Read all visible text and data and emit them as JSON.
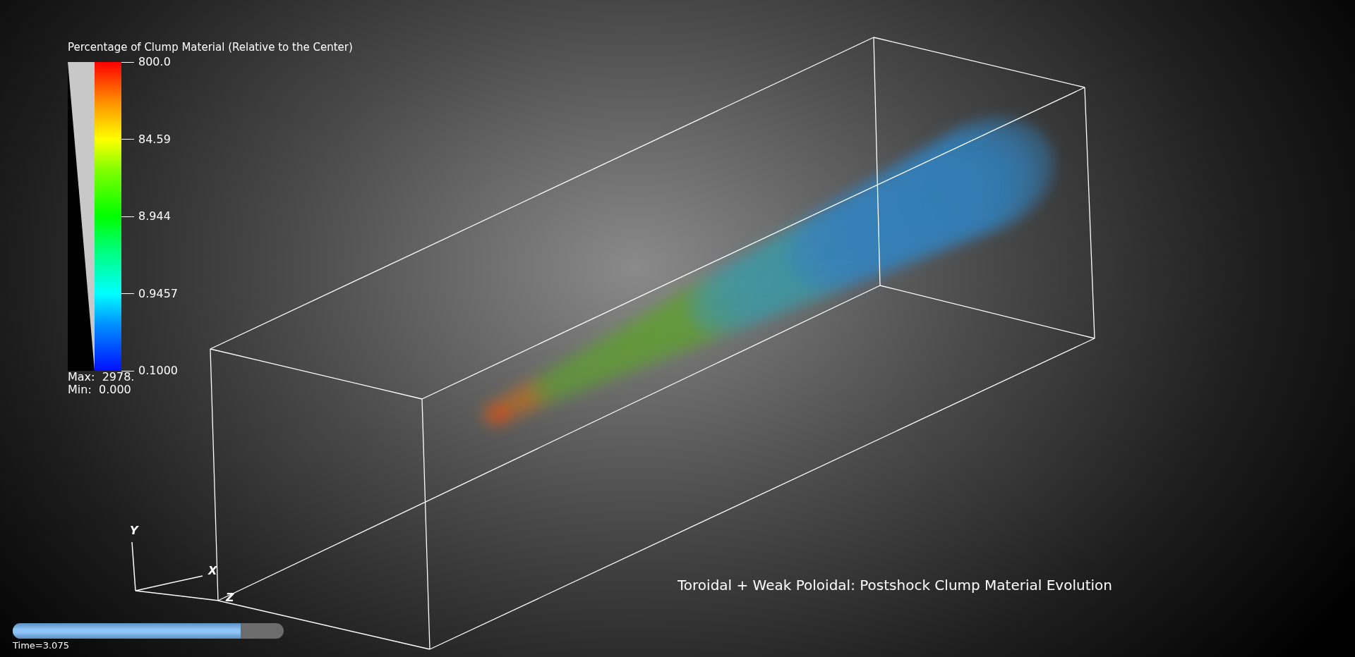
{
  "legend": {
    "title": "Percentage of Clump Material (Relative to the Center)",
    "ticks": [
      "800.0",
      "84.59",
      "8.944",
      "0.9457",
      "0.1000"
    ],
    "max": "Max:  2978.",
    "min": "Min:  0.000"
  },
  "axes": {
    "y": "Y",
    "x": "X",
    "z": "Z"
  },
  "caption": "Toroidal + Weak Poloidal: Postshock Clump Material Evolution",
  "time_slider": {
    "level": 0.84,
    "label": "Time=3.075"
  }
}
